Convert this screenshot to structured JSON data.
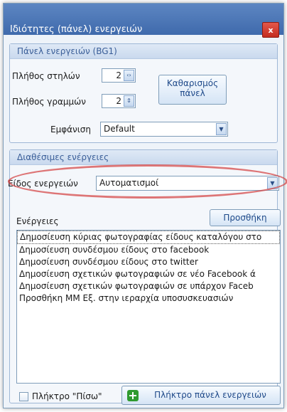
{
  "window": {
    "title": "Ιδιότητες (πάνελ) ενεργειών",
    "close_label": "x"
  },
  "panel_group": {
    "header": "Πάνελ ενεργειών (BG1)",
    "columns_label": "Πλήθος στηλών",
    "columns_value": "2",
    "rows_label": "Πλήθος γραμμών",
    "rows_value": "2",
    "clear_button_line1": "Καθαρισμός",
    "clear_button_line2": "πάνελ",
    "display_label": "Εμφάνιση",
    "display_value": "Default"
  },
  "actions_group": {
    "header": "Διαθέσιμες ενέργειες",
    "type_label": "Είδος ενεργειών",
    "type_value": "Αυτοματισμοί",
    "actions_label": "Ενέργειες",
    "add_button": "Προσθήκη",
    "items": [
      "Δημοσίευση κύριας φωτογραφίας είδους καταλόγου στο",
      "Δημοσίευση συνδέσμου είδους στο facebook",
      "Δημοσίευση συνδέσμου είδους στο twitter",
      "Δημοσίευση σχετικών φωτογραφιών σε νέο Facebook ά",
      "Δημοσίευση σχετικών φωτογραφιών σε υπάρχον Faceb",
      "Προσθήκη ΜΜ Εξ. στην ιεραρχία υποσυσκευασιών"
    ],
    "back_key_label": "Πλήκτρο \"Πίσω\"",
    "panel_key_button": "Πλήκτρο πάνελ ενεργειών"
  }
}
